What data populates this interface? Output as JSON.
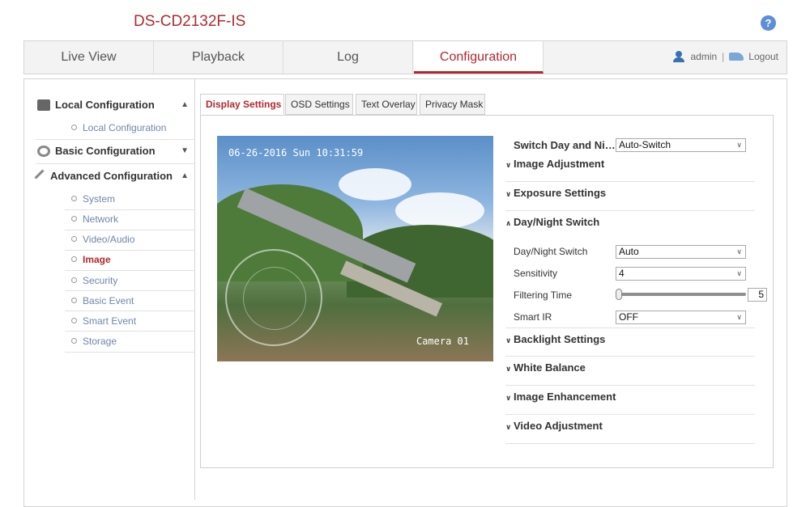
{
  "header": {
    "device_model": "DS-CD2132F-IS",
    "help": "?"
  },
  "nav": {
    "tabs": [
      {
        "label": "Live View"
      },
      {
        "label": "Playback"
      },
      {
        "label": "Log"
      },
      {
        "label": "Configuration"
      }
    ],
    "active": "Configuration",
    "user": "admin",
    "separator": "|",
    "logout": "Logout"
  },
  "sidebar": {
    "local_configuration": "Local Configuration",
    "local_configuration_item": "Local Configuration",
    "basic_configuration": "Basic Configuration",
    "advanced_configuration": "Advanced Configuration",
    "items": [
      {
        "label": "System"
      },
      {
        "label": "Network"
      },
      {
        "label": "Video/Audio"
      },
      {
        "label": "Image"
      },
      {
        "label": "Security"
      },
      {
        "label": "Basic Event"
      },
      {
        "label": "Smart Event"
      },
      {
        "label": "Storage"
      }
    ],
    "active_item": "Image"
  },
  "subtabs": {
    "display_settings": "Display Settings",
    "osd_settings": "OSD Settings",
    "text_overlay": "Text Overlay",
    "privacy_mask": "Privacy Mask"
  },
  "video": {
    "timestamp": "06-26-2016 Sun 10:31:59",
    "camera_label": "Camera 01"
  },
  "settings": {
    "switch_day_night_label": "Switch Day and Ni…",
    "switch_day_night_value": "Auto-Switch",
    "sections": {
      "image_adjustment": "Image Adjustment",
      "exposure_settings": "Exposure Settings",
      "day_night_switch": "Day/Night Switch",
      "backlight_settings": "Backlight Settings",
      "white_balance": "White Balance",
      "image_enhancement": "Image Enhancement",
      "video_adjustment": "Video Adjustment"
    },
    "day_night_switch_label": "Day/Night Switch",
    "day_night_switch_value": "Auto",
    "sensitivity_label": "Sensitivity",
    "sensitivity_value": "4",
    "filtering_time_label": "Filtering Time",
    "filtering_time_value": "5",
    "smart_ir_label": "Smart IR",
    "smart_ir_value": "OFF"
  },
  "colors": {
    "accent": "#b3282d",
    "link": "#6f86a8"
  }
}
